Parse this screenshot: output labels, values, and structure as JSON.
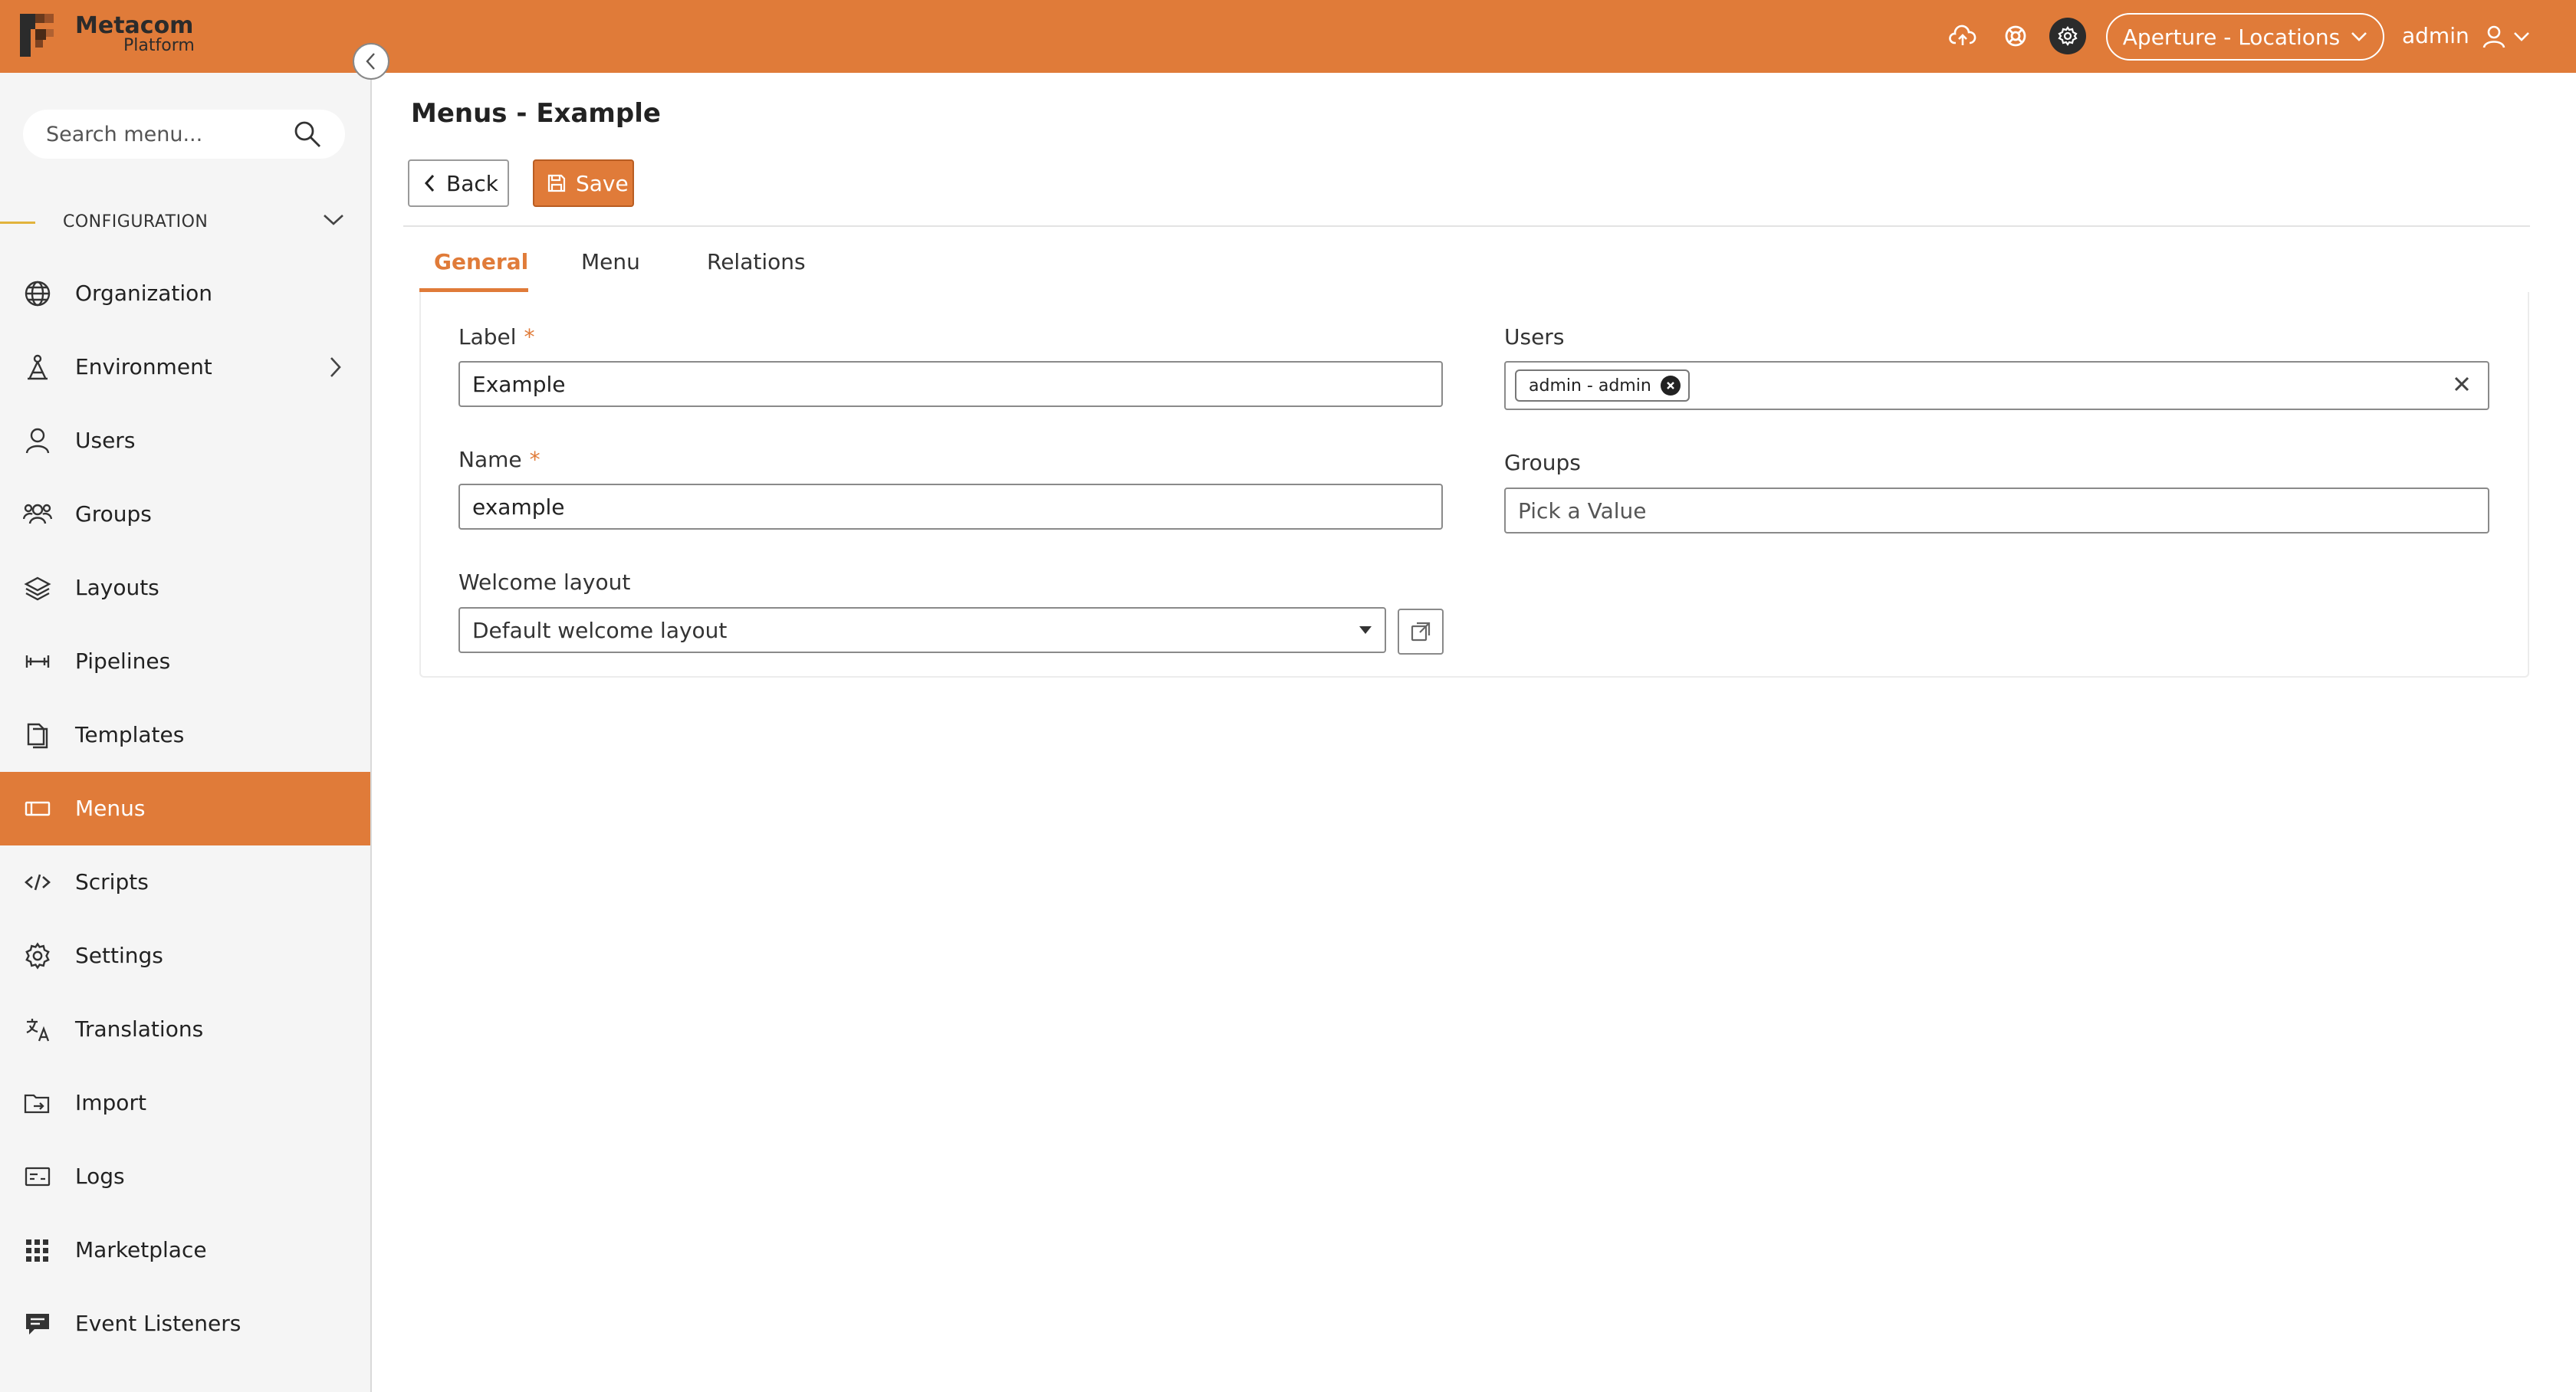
{
  "colors": {
    "accent": "#E07B39",
    "dark": "#2b2b2b",
    "section_bar": "#e2b33c"
  },
  "topbar": {
    "logo_title": "Metacom",
    "logo_subtitle": "Platform",
    "icons": [
      "cloud-upload-icon",
      "support-icon",
      "settings-icon"
    ],
    "environment": "Aperture - Locations",
    "user": "admin"
  },
  "sidebar": {
    "search_placeholder": "Search menu...",
    "section": "CONFIGURATION",
    "items": [
      {
        "label": "Organization",
        "icon": "globe-icon"
      },
      {
        "label": "Environment",
        "icon": "environment-icon",
        "has_children": true
      },
      {
        "label": "Users",
        "icon": "user-icon"
      },
      {
        "label": "Groups",
        "icon": "groups-icon"
      },
      {
        "label": "Layouts",
        "icon": "layers-icon"
      },
      {
        "label": "Pipelines",
        "icon": "pipeline-icon"
      },
      {
        "label": "Templates",
        "icon": "templates-icon"
      },
      {
        "label": "Menus",
        "icon": "menu-icon",
        "active": true
      },
      {
        "label": "Scripts",
        "icon": "code-icon"
      },
      {
        "label": "Settings",
        "icon": "gear-icon"
      },
      {
        "label": "Translations",
        "icon": "translate-icon"
      },
      {
        "label": "Import",
        "icon": "import-icon"
      },
      {
        "label": "Logs",
        "icon": "logs-icon"
      },
      {
        "label": "Marketplace",
        "icon": "marketplace-icon"
      },
      {
        "label": "Event Listeners",
        "icon": "event-icon"
      }
    ]
  },
  "main": {
    "title": "Menus - Example",
    "back_label": "Back",
    "save_label": "Save",
    "tabs": [
      {
        "label": "General",
        "active": true
      },
      {
        "label": "Menu"
      },
      {
        "label": "Relations"
      }
    ],
    "form": {
      "label_label": "Label",
      "label_value": "Example",
      "name_label": "Name",
      "name_value": "example",
      "welcome_layout_label": "Welcome layout",
      "welcome_layout_value": "Default welcome layout",
      "users_label": "Users",
      "users_chip": "admin - admin",
      "groups_label": "Groups",
      "groups_placeholder": "Pick a Value",
      "required_mark": "*"
    }
  }
}
